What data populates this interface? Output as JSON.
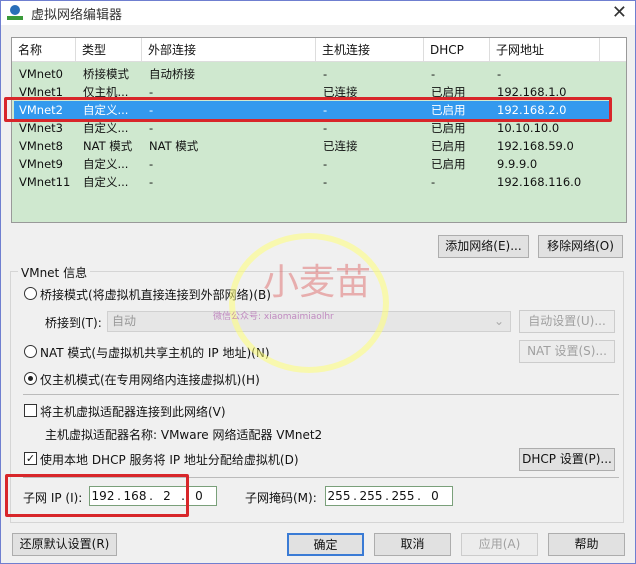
{
  "window": {
    "title": "虚拟网络编辑器",
    "close": "✕"
  },
  "table": {
    "headers": [
      "名称",
      "类型",
      "外部连接",
      "主机连接",
      "DHCP",
      "子网地址"
    ],
    "rows": [
      [
        "VMnet0",
        "桥接模式",
        "自动桥接",
        "-",
        "-",
        "-"
      ],
      [
        "VMnet1",
        "仅主机...",
        "-",
        "已连接",
        "已启用",
        "192.168.1.0"
      ],
      [
        "VMnet2",
        "自定义...",
        "-",
        "-",
        "已启用",
        "192.168.2.0"
      ],
      [
        "VMnet3",
        "自定义...",
        "-",
        "-",
        "已启用",
        "10.10.10.0"
      ],
      [
        "VMnet8",
        "NAT 模式",
        "NAT 模式",
        "已连接",
        "已启用",
        "192.168.59.0"
      ],
      [
        "VMnet9",
        "自定义...",
        "-",
        "-",
        "已启用",
        "9.9.9.0"
      ],
      [
        "VMnet11",
        "自定义...",
        "-",
        "-",
        "-",
        "192.168.116.0"
      ]
    ],
    "selected_index": 2
  },
  "buttons": {
    "add": "添加网络(E)...",
    "remove": "移除网络(O)",
    "auto": "自动设置(U)...",
    "nat": "NAT 设置(S)...",
    "dhcp": "DHCP 设置(P)...",
    "restore": "还原默认设置(R)",
    "ok": "确定",
    "cancel": "取消",
    "apply": "应用(A)",
    "help": "帮助"
  },
  "info": {
    "group_label": "VMnet 信息",
    "bridge_radio": "桥接模式(将虚拟机直接连接到外部网络)(B)",
    "bridge_to_label": "桥接到(T):",
    "bridge_to_value": "自动",
    "nat_radio": "NAT 模式(与虚拟机共享主机的 IP 地址)(N)",
    "host_radio": "仅主机模式(在专用网络内连接虚拟机)(H)",
    "connect_adapter": "将主机虚拟适配器连接到此网络(V)",
    "adapter_name": "主机虚拟适配器名称: VMware 网络适配器 VMnet2",
    "use_dhcp": "使用本地 DHCP 服务将 IP 地址分配给虚拟机(D)",
    "dhcp_check": "✓",
    "subnet_ip_label": "子网 IP (I):",
    "subnet_ip": [
      "192",
      "168",
      "2",
      "0"
    ],
    "mask_label": "子网掩码(M):",
    "mask": [
      "255",
      "255",
      "255",
      "0"
    ]
  },
  "watermark": {
    "name": "小麦苗",
    "sub": "微信公众号: xiaomaimiaolhr"
  }
}
